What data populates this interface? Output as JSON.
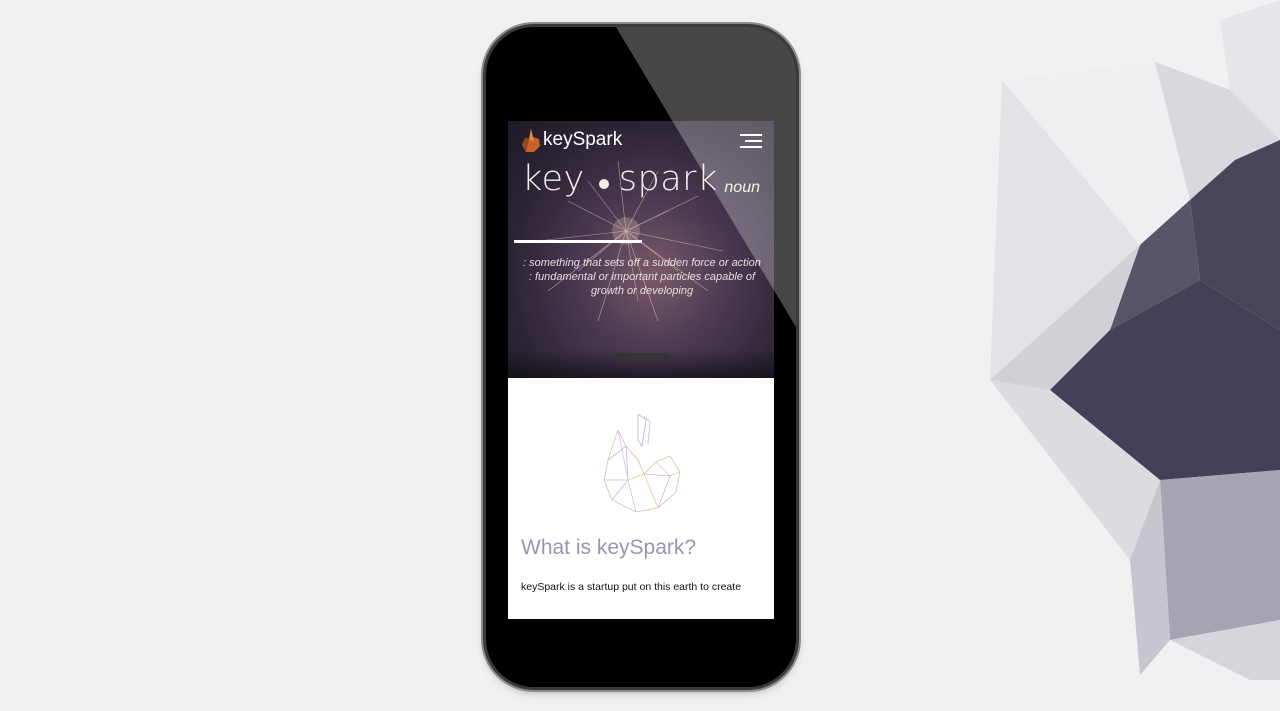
{
  "app": {
    "brand": "keySpark"
  },
  "hero": {
    "word_first": "key",
    "word_second": "spark",
    "part_of_speech": "noun",
    "definitions": [
      ": something that sets off a sudden force or action",
      ": fundamental or important particles capable of",
      "growth or developing"
    ]
  },
  "section": {
    "heading": "What is keySpark?",
    "intro": "keySpark is a startup put on this earth to create"
  },
  "icons": {
    "menu": "hamburger-menu-icon",
    "logo": "flame-logo-icon"
  },
  "colors": {
    "background": "#f1f1f1",
    "heading": "#9a93b2",
    "logo_orange": "#d2692a"
  }
}
